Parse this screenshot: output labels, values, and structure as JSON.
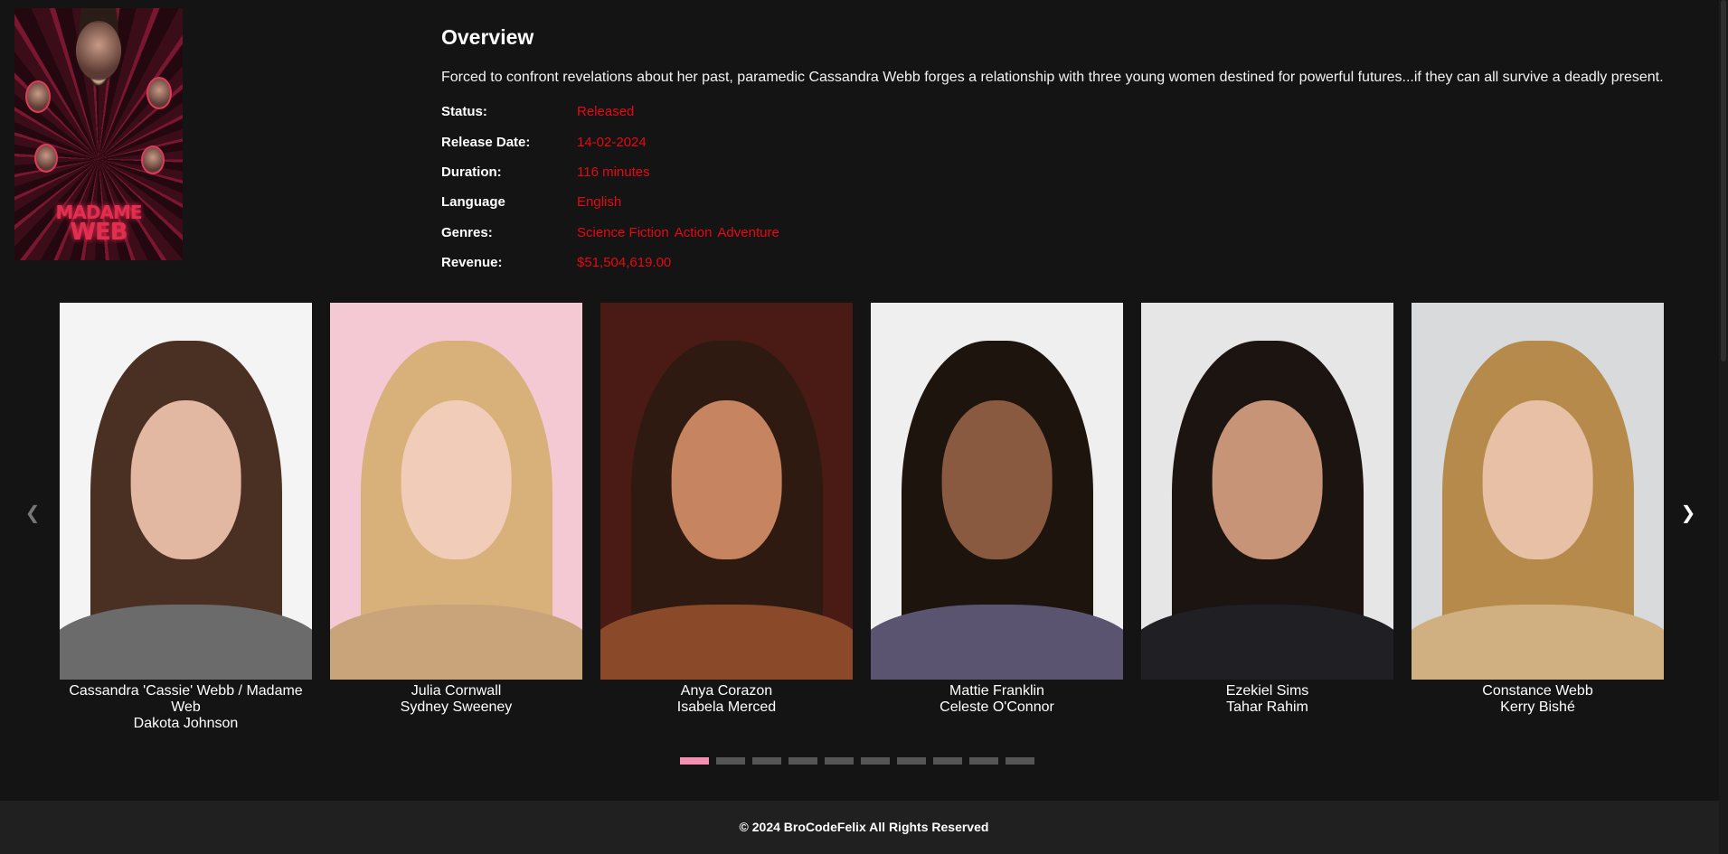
{
  "poster": {
    "title_line1": "MADAME",
    "title_line2": "WEB",
    "colors": {
      "accent": "#e0304f",
      "background": "#2a0a14"
    }
  },
  "overview": {
    "heading": "Overview",
    "description": "Forced to confront revelations about her past, paramedic Cassandra Webb forges a relationship with three young women destined for powerful futures...if they can all survive a deadly present.",
    "rows": [
      {
        "label": "Status:",
        "value": "Released"
      },
      {
        "label": "Release Date:",
        "value": "14-02-2024"
      },
      {
        "label": "Duration:",
        "value": "116 minutes"
      },
      {
        "label": "Language",
        "value": "English"
      }
    ],
    "genres_label": "Genres:",
    "genres": [
      "Science Fiction",
      "Action",
      "Adventure"
    ],
    "revenue_label": "Revenue:",
    "revenue": "$51,504,619.00",
    "value_color": "#e50914"
  },
  "carousel": {
    "prev_icon": "chevron-left-icon",
    "next_icon": "chevron-right-icon",
    "cast": [
      {
        "role": "Cassandra 'Cassie' Webb / Madame Web",
        "actor": "Dakota Johnson",
        "bg": "#f4f4f4",
        "hair": "#4a3022",
        "skin": "#e3b8a2",
        "top": "#6b6b6b"
      },
      {
        "role": "Julia Cornwall",
        "actor": "Sydney Sweeney",
        "bg": "#f5c9d3",
        "hair": "#d8b07a",
        "skin": "#f1cdb9",
        "top": "#c9a37a"
      },
      {
        "role": "Anya Corazon",
        "actor": "Isabela Merced",
        "bg": "#4a1a14",
        "hair": "#2e1a10",
        "skin": "#c68460",
        "top": "#8a4a2a"
      },
      {
        "role": "Mattie Franklin",
        "actor": "Celeste O'Connor",
        "bg": "#efefef",
        "hair": "#1e140e",
        "skin": "#8a5a40",
        "top": "#5a5470"
      },
      {
        "role": "Ezekiel Sims",
        "actor": "Tahar Rahim",
        "bg": "#e6e6e6",
        "hair": "#1c1410",
        "skin": "#c79478",
        "top": "#1f1f24"
      },
      {
        "role": "Constance Webb",
        "actor": "Kerry Bishé",
        "bg": "#d8dadc",
        "hair": "#b58a4a",
        "skin": "#e8c0a6",
        "top": "#d0b080"
      }
    ],
    "pagination": {
      "total": 10,
      "active": 1,
      "active_color": "#f48fb1"
    }
  },
  "footer": {
    "text": "© 2024 BroCodeFelix All Rights Reserved"
  }
}
